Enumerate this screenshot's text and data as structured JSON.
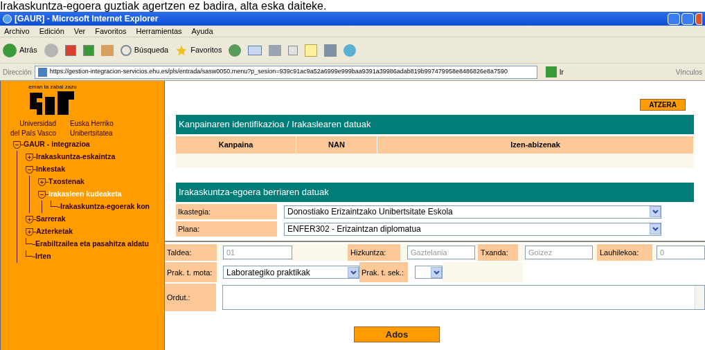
{
  "caption": "Irakaskuntza-egoera guztiak agertzen ez badira, alta eska daiteke.",
  "window": {
    "title": "[GAUR] - Microsoft Internet Explorer"
  },
  "menu": [
    "Archivo",
    "Edición",
    "Ver",
    "Favoritos",
    "Herramientas",
    "Ayuda"
  ],
  "toolbar": {
    "back": "Atrás",
    "search": "Búsqueda",
    "favorites": "Favoritos"
  },
  "address": {
    "label": "Dirección",
    "value": "https://gestion-integracion-servicios.ehu.es/pls/entrada/sasw0050.menu?p_sesion=939c91ac9a52a6999e999baa9391a39986adab819b997479958e8486826e8a7590",
    "go": "Ir",
    "links": "Vínculos"
  },
  "sidebar": {
    "motto": "eman ta zabal zazu",
    "university_es": [
      "Universidad",
      "del País Vasco"
    ],
    "university_eu": [
      "Euska Herriko",
      "Unibertsitatea"
    ],
    "tree": [
      {
        "label": "GAUR - integrazioa",
        "expanded": true,
        "selected": false,
        "children": [
          {
            "label": "Irakaskuntza-eskaintza",
            "expanded": false,
            "selected": false
          },
          {
            "label": "Inkestak",
            "expanded": true,
            "selected": false,
            "children": [
              {
                "label": "Txostenak",
                "expanded": false,
                "selected": false
              },
              {
                "label": "Irakasleen kudeaketa",
                "expanded": true,
                "selected": true,
                "children": [
                  {
                    "label": "Irakaskuntza-egoerak kon",
                    "selected": false
                  }
                ]
              }
            ]
          },
          {
            "label": "Sarrerak",
            "expanded": false,
            "selected": false
          },
          {
            "label": "Azterketak",
            "expanded": false,
            "selected": false
          },
          {
            "label": "Erabiltzailea eta pasahitza aldatu",
            "selected": false
          },
          {
            "label": "Irten",
            "selected": false
          }
        ]
      }
    ]
  },
  "back_button": "ATZERA",
  "section1": {
    "title": "Kanpainaren identifikazioa / Irakaslearen datuak",
    "columns": [
      "Kanpaina",
      "NAN",
      "Izen-abizenak"
    ]
  },
  "section2": {
    "title": "Irakaskuntza-egoera berriaren datuak",
    "fields": [
      {
        "label": "Ikastegia:",
        "value": "Donostiako Erizaintzako Unibertsitate Eskola"
      },
      {
        "label": "Plana:",
        "value": "ENFER302 - Erizaintzan diplomatua"
      }
    ]
  },
  "form": {
    "taldea": {
      "label": "Taldea:",
      "value": "01",
      "disabled": true
    },
    "hizkuntza": {
      "label": "Hizkuntza:",
      "value": "Gaztelania",
      "disabled": true
    },
    "txanda": {
      "label": "Txanda:",
      "value": "Goizez",
      "disabled": true
    },
    "lauhilekoa": {
      "label": "Lauhilekoa:",
      "value": "0",
      "disabled": true
    },
    "prak_mota": {
      "label": "Prak. t. mota:",
      "value": "Laborategiko praktikak"
    },
    "prak_sek": {
      "label": "Prak. t. sek.:"
    },
    "ordut": {
      "label": "Ordut.:"
    }
  },
  "submit": "Ados"
}
